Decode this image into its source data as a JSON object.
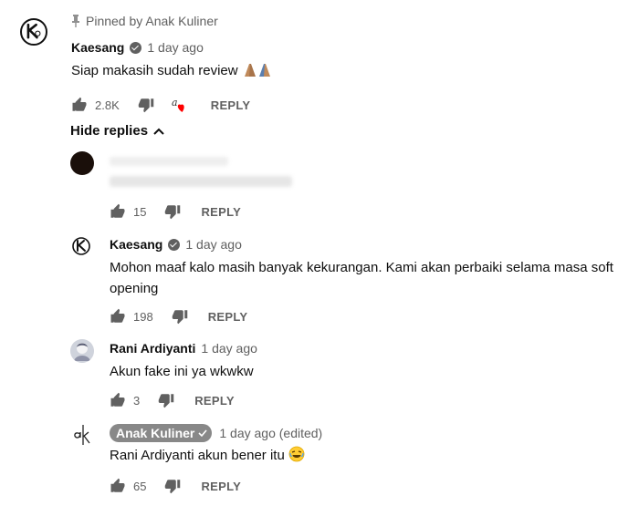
{
  "pinned_label": "Pinned by Anak Kuliner",
  "toggle_label": "Hide replies",
  "main_comment": {
    "author": "Kaesang",
    "time": "1 day ago",
    "text": "Siap makasih sudah review",
    "likes": "2.8K",
    "reply_label": "REPLY"
  },
  "replies": [
    {
      "author": "",
      "time": "",
      "text": "",
      "likes": "15",
      "reply_label": "REPLY"
    },
    {
      "author": "Kaesang",
      "time": "1 day ago",
      "text": "Mohon maaf kalo masih banyak kekurangan. Kami akan perbaiki selama masa soft opening",
      "likes": "198",
      "reply_label": "REPLY"
    },
    {
      "author": "Rani Ardiyanti",
      "time": "1 day ago",
      "text": "Akun fake ini ya wkwkw",
      "likes": "3",
      "reply_label": "REPLY"
    },
    {
      "author": "Anak Kuliner",
      "time": "1 day ago (edited)",
      "text": "Rani Ardiyanti akun bener itu",
      "likes": "65",
      "reply_label": "REPLY"
    }
  ],
  "colors": {
    "text": "#0f0f0f",
    "secondary": "#606060",
    "heart": "#ff0000",
    "owner_chip": "#888888"
  },
  "icons": [
    "pin-icon",
    "verified-icon",
    "thumbs-up-icon",
    "thumbs-down-icon",
    "creator-heart-icon",
    "chevron-up-icon",
    "praying-hands-emoji",
    "laughing-emoji"
  ]
}
